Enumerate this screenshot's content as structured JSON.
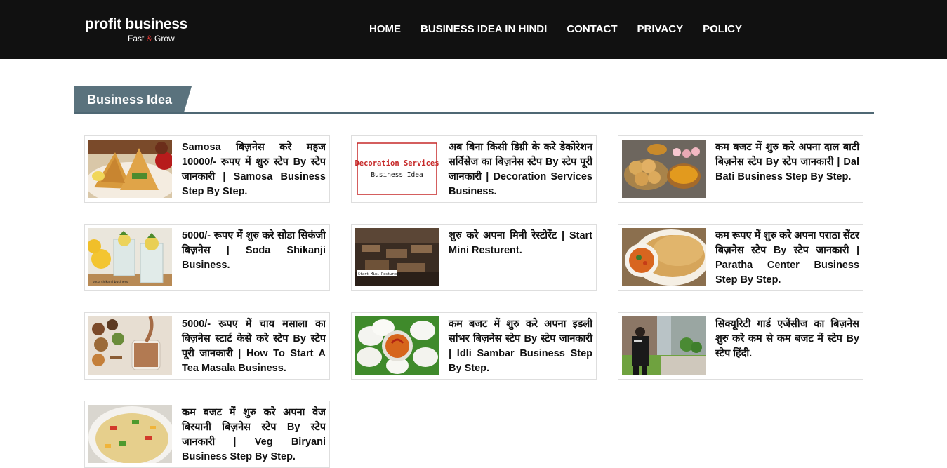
{
  "site": {
    "name": "profit business",
    "tagline_a": "Fast",
    "tagline_amp": "&",
    "tagline_b": "Grow"
  },
  "nav": [
    "HOME",
    "BUSINESS IDEA IN HINDI",
    "CONTACT",
    "PRIVACY",
    "POLICY"
  ],
  "section": {
    "title": "Business Idea"
  },
  "posts": [
    {
      "title": "Samosa बिज़नेस करे महज 10000/- रूपए में शुरु स्टेप By स्टेप जानकारी | Samosa Business Step By Step.",
      "thumb": "samosa-image"
    },
    {
      "title": "अब बिना किसी डिग्री के करे डेकोरेशन सर्विसेज का बिज़नेस स्टेप By स्टेप पूरी जानकारी | Decoration Services Business.",
      "thumb": "decoration-services-image",
      "thumb_line1": "Decoration Services",
      "thumb_line2": "Business Idea"
    },
    {
      "title": "कम बजट में शुरु करे अपना दाल बाटी बिज़नेस स्टेप By स्टेप जानकारी | Dal Bati Business Step By Step.",
      "thumb": "dal-bati-image"
    },
    {
      "title": "5000/- रूपए में शुरु करे सोडा सिकंजी बिज़नेस | Soda Shikanji Business.",
      "thumb": "soda-shikanji-image",
      "thumb_caption": "soda shikanji business"
    },
    {
      "title": "शुरु करे अपना मिनी रेस्टोरेंट | Start Mini Resturent.",
      "thumb": "mini-restaurant-image",
      "thumb_caption": "Start Mini Resturent"
    },
    {
      "title": "कम रूपए में शुरु करे अपना पराठा सेंटर बिज़नेस स्टेप By स्टेप जानकारी | Paratha Center Business Step By Step.",
      "thumb": "paratha-image"
    },
    {
      "title": "5000/- रूपए में चाय मसाला का बिज़नेस स्टार्ट केसे करे स्टेप By स्टेप पूरी जानकारी | How To Start A Tea Masala Business.",
      "thumb": "tea-masala-image"
    },
    {
      "title": "कम बजट में शुरु करे अपना इडली सांभर बिज़नेस स्टेप By स्टेप जानकारी | Idli Sambar Business Step By Step.",
      "thumb": "idli-sambar-image"
    },
    {
      "title": "सिक्यूरिटी गार्ड एजेंसीज का बिज़नेस शुरु करे कम से कम बजट में स्टेप By स्टेप हिंदी.",
      "thumb": "security-guard-image"
    },
    {
      "title": "कम बजट में शुरु करे अपना वेज बिरयानी बिज़नेस स्टेप By स्टेप जानकारी | Veg Biryani Business Step By Step.",
      "thumb": "veg-biryani-image"
    }
  ]
}
